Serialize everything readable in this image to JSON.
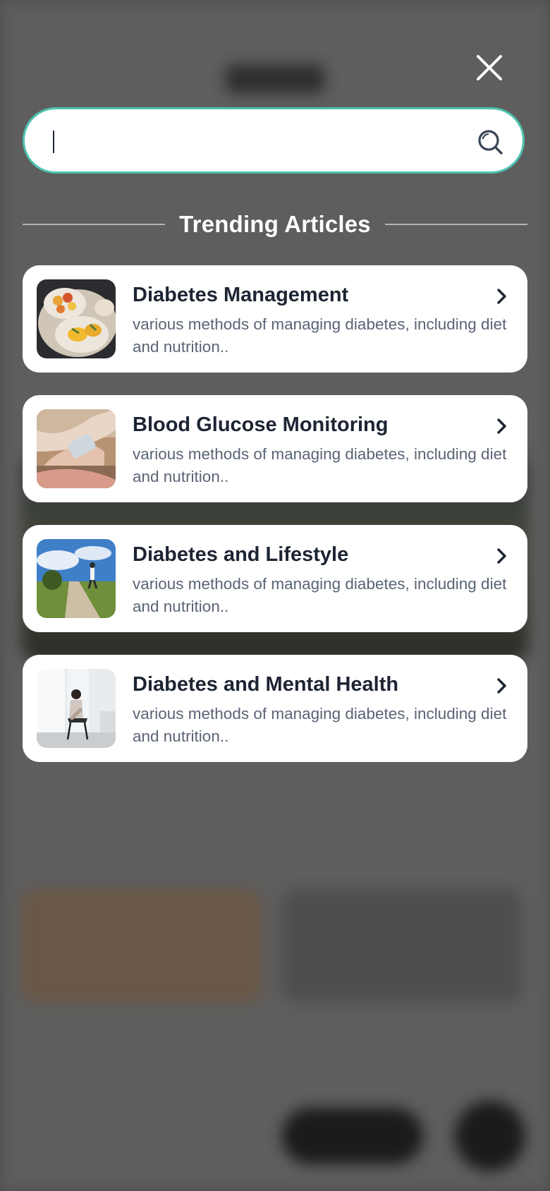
{
  "search": {
    "value": "",
    "placeholder": ""
  },
  "trending": {
    "heading": "Trending Articles",
    "articles": [
      {
        "title": "Diabetes Management",
        "description": "various methods of managing diabetes, including diet and nutrition..",
        "image": "fruit-plate-photo"
      },
      {
        "title": "Blood Glucose Monitoring",
        "description": "various methods of managing diabetes, including diet and nutrition..",
        "image": "glucose-meter-photo"
      },
      {
        "title": "Diabetes and Lifestyle",
        "description": "various methods of managing diabetes, including diet and nutrition..",
        "image": "runner-path-photo"
      },
      {
        "title": "Diabetes and Mental Health",
        "description": "various methods of managing diabetes, including diet and nutrition..",
        "image": "person-window-photo"
      }
    ]
  },
  "colors": {
    "search_border": "#4dc3b1",
    "card_bg": "#ffffff",
    "title": "#1d2433",
    "desc": "#5a6475"
  }
}
